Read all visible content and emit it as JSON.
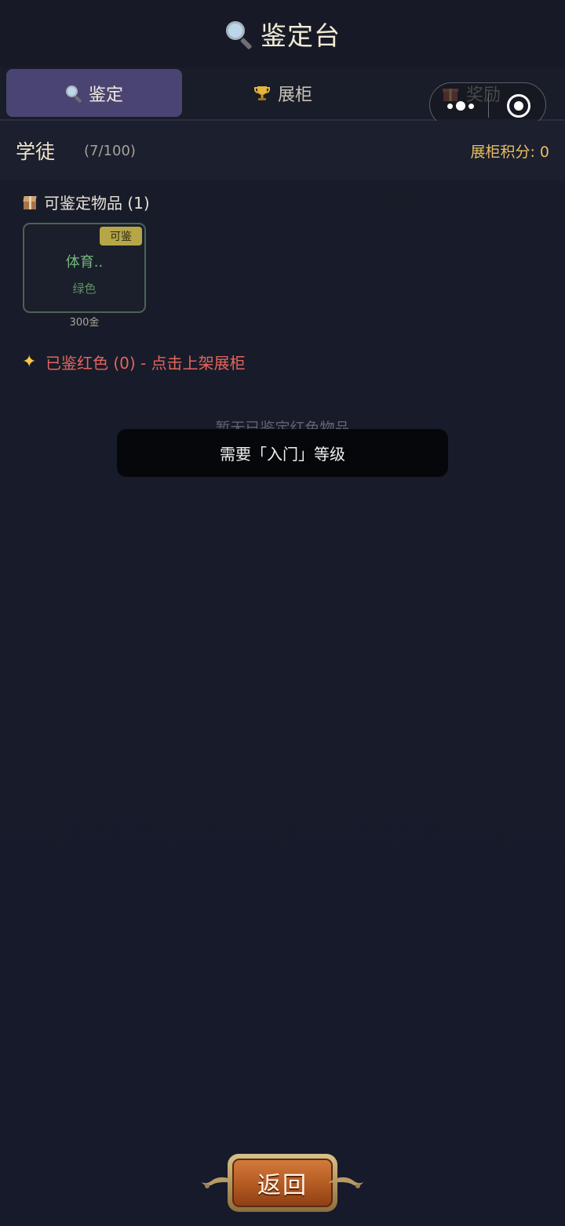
{
  "header": {
    "title": "鉴定台"
  },
  "tabs": [
    {
      "label": "鉴定",
      "icon": "magnifier-icon",
      "active": true
    },
    {
      "label": "展柜",
      "icon": "trophy-icon",
      "active": false
    },
    {
      "label": "奖励",
      "icon": "gift-icon",
      "active": false
    }
  ],
  "status": {
    "rank": "学徒",
    "progress": "(7/100)",
    "score_label": "展柜积分: 0"
  },
  "identifiable": {
    "title": "可鉴定物品 (1)",
    "items": [
      {
        "name": "体育..",
        "grade": "绿色",
        "badge": "可鉴",
        "price": "300金"
      }
    ]
  },
  "identified": {
    "title": "已鉴红色 (0) - 点击上架展柜",
    "empty": "暂无已鉴定红色物品"
  },
  "toast": {
    "message": "需要「入门」等级"
  },
  "footer": {
    "back_label": "返回"
  },
  "colors": {
    "accent_tab": "#4a4472",
    "score": "#e9be60",
    "item_green": "#74b77d",
    "red_title": "#e2655c",
    "badge": "#b7a648"
  }
}
